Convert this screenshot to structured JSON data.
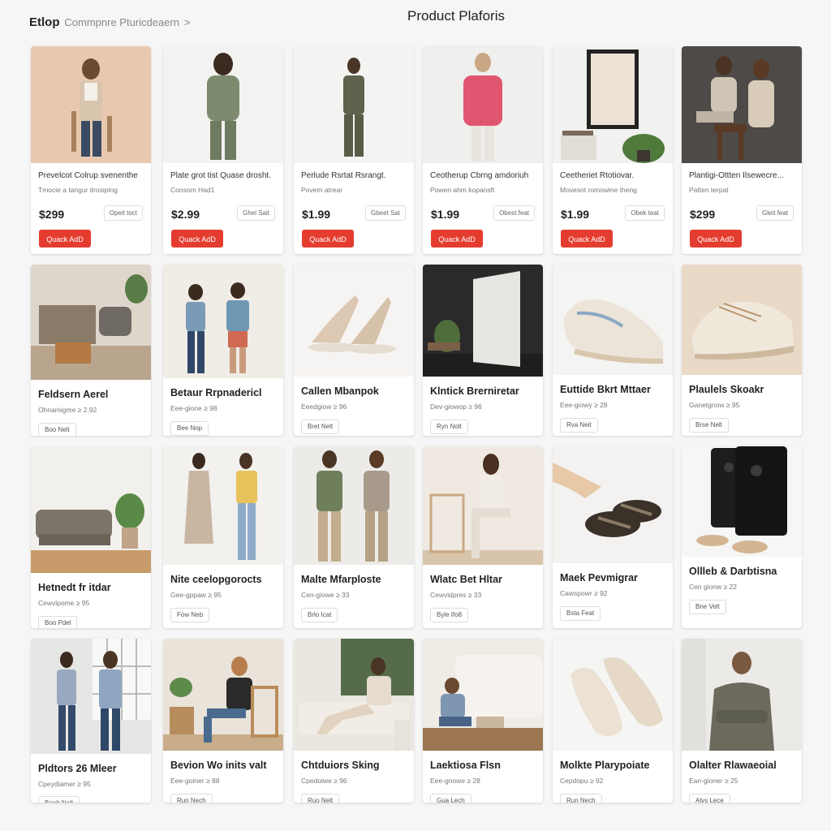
{
  "header": {
    "brand": "Etlop",
    "breadcrumb": "Commpnre Pturicdeaern",
    "chevron": ">",
    "title": "Product Plaforis"
  },
  "colors": {
    "accent": "#e43d2f",
    "background": "#f6f6f6"
  },
  "row1": [
    {
      "title": "Prevelcot Colrup svenenthe",
      "sub": "Tmocie a tangur itrosiping",
      "price": "$299",
      "ghost": "Opeit toct",
      "button": "Quack AdD",
      "image": "woman-beige-cardigan"
    },
    {
      "title": "Plate grot tist Quase drosht.",
      "sub": "Consom Had1",
      "price": "$2.99",
      "ghost": "Ghel Sait",
      "button": "Quack AdD",
      "image": "man-green-hoodie"
    },
    {
      "title": "Perlude Rsrtat Rsrangt.",
      "sub": "Povem atrear",
      "price": "$1.99",
      "ghost": "Gbeet Sat",
      "button": "Quack AdD",
      "image": "man-utility-outfit"
    },
    {
      "title": "Ceotherup Cbrng amdoriuh",
      "sub": "Powen ahm kopansft",
      "price": "$1.99",
      "ghost": "Obest feat",
      "button": "Quack AdD",
      "image": "woman-pink-hoodie"
    },
    {
      "title": "Ceetheriet Rtotiovar.",
      "sub": "Movesnt romowine theng",
      "price": "$1.99",
      "ghost": "Obek teat",
      "button": "Quack AdD",
      "image": "framed-art-shelf"
    },
    {
      "title": "Plantigi-Ottten Ilsewecre...",
      "sub": "Patten terpat",
      "price": "$299",
      "ghost": "Gleit feat",
      "button": "Quack AdD",
      "image": "couple-seated"
    }
  ],
  "row2": [
    {
      "title": "Feldsern Aerel",
      "sub": "Ohnamigme  ≥ 2.92",
      "button": "Boo Nelt",
      "image": "living-room-clutter"
    },
    {
      "title": "Betaur Rrpnadericl",
      "sub": "Eee-gione  ≥ 98",
      "button": "Bee Nop",
      "image": "two-women-dotted-wall"
    },
    {
      "title": "Callen Mbanpok",
      "sub": "Eeedgiow  ≥ 96",
      "button": "Bret Nelt",
      "image": "nude-heels"
    },
    {
      "title": "Klntick Brerniretar",
      "sub": "Dev-giowop  ≥ 96",
      "button": "Ryn Nolt",
      "image": "dark-room-canvas"
    },
    {
      "title": "Euttide Bkrt Mttaer",
      "sub": "Eee-giowy  ≥ 28",
      "button": "Rva Neit",
      "image": "floral-sneaker"
    },
    {
      "title": "Plaulels Skoakr",
      "sub": "Ganetgnow  ≥ 95",
      "button": "Brse Nelt",
      "image": "lace-sneaker"
    }
  ],
  "row3": [
    {
      "title": "Hetnedt fr itdar",
      "sub": "Cewvipome  ≥ 95",
      "button": "Boo Pdel",
      "image": "bright-sofa-room"
    },
    {
      "title": "Nite ceelopgorocts",
      "sub": "Gee-gppaw  ≥ 95",
      "button": "Fow Neb",
      "image": "two-women-dress"
    },
    {
      "title": "Malte Mfarploste",
      "sub": "Cen-giowe  ≥ 33",
      "button": "Brlo Icat",
      "image": "two-men-casual"
    },
    {
      "title": "Wlatc Bet Hltar",
      "sub": "Cewvidpres  ≥ 33",
      "button": "Byle Ifo8",
      "image": "woman-on-chair"
    },
    {
      "title": "Maek Pevmigrar",
      "sub": "Cawspowr  ≥ 92",
      "button": "Bsta Feat",
      "image": "black-sandals"
    },
    {
      "title": "Ollleb & Darbtisna",
      "sub": "Cen gionw  ≥ 22",
      "button": "Bne Velt",
      "image": "black-speakers"
    }
  ],
  "row4": [
    {
      "title": "Pldtors 26 Mleer",
      "sub": "Cpeydiamer  ≥ 95",
      "button": "Bnob Nelt",
      "image": "two-people-window"
    },
    {
      "title": "Bevion Wo inits valt",
      "sub": "Eee-goiner  ≥ 88",
      "button": "Run Nech",
      "image": "man-wood-chair"
    },
    {
      "title": "Chtduiors Sking",
      "sub": "Cpedoiwe  ≥ 96",
      "button": "Ruo Nelt",
      "image": "woman-lounge"
    },
    {
      "title": "Laektiosa Flsn",
      "sub": "Eee-gnowe  ≥ 28",
      "button": "Gua Lech",
      "image": "child-on-sofa"
    },
    {
      "title": "Molkte Plarypoiate",
      "sub": "Cepdopu  ≥ 92",
      "button": "Run Nech",
      "image": "cream-flats"
    },
    {
      "title": "Olalter Rlawaeoial",
      "sub": "Ean-gioner  ≥ 25",
      "button": "Alvs Lece",
      "image": "woman-knit-sweater"
    }
  ]
}
